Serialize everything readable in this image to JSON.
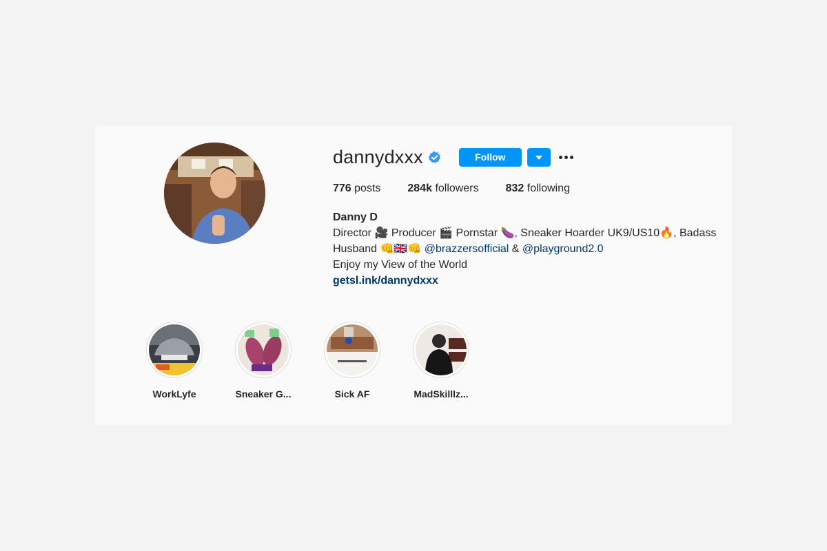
{
  "profile": {
    "username": "dannydxxx",
    "follow_label": "Follow",
    "stats": {
      "posts_count": "776",
      "posts_label": "posts",
      "followers_count": "284k",
      "followers_label": "followers",
      "following_count": "832",
      "following_label": "following"
    },
    "bio": {
      "name": "Danny D",
      "line1": "Director 🎥 Producer 🎬 Pornstar 🍆, Sneaker Hoarder UK9/US10🔥, Badass",
      "line2_prefix": "Husband 👊🇬🇧👊 ",
      "mention1": "@brazzersofficial",
      "line2_amp": " & ",
      "mention2": "@playground2.0",
      "line3": "Enjoy my View of the World",
      "link": "getsl.ink/dannydxxx"
    }
  },
  "highlights": [
    {
      "label": "WorkLyfe"
    },
    {
      "label": "Sneaker G..."
    },
    {
      "label": "Sick AF"
    },
    {
      "label": "MadSkilllz..."
    }
  ],
  "colors": {
    "accent": "#0095f6",
    "link": "#00376b",
    "verified": "#3897f0"
  }
}
